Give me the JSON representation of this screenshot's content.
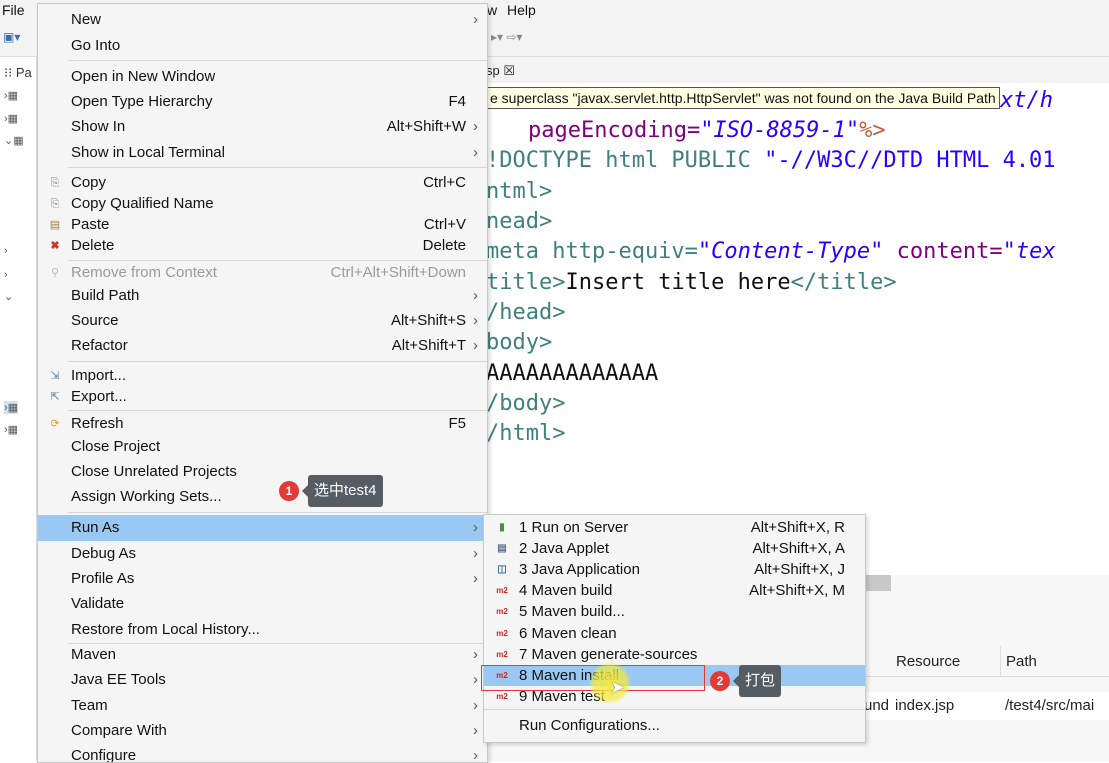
{
  "menubar": {
    "file": "File",
    "help": "Help",
    "w_fragment": "w"
  },
  "editor": {
    "tab_fragment": "sp ☒",
    "warning_tooltip": "e superclass \"javax.servlet.http.HttpServlet\" was not found on the Java Build Path",
    "code_lines": [
      {
        "a": "pageEncoding=",
        "b": "\"ISO-8859-1\"",
        "c": "%>"
      },
      {
        "a": "!DOCTYPE html PUBLIC ",
        "b": "\"-//W3C//DTD HTML 4.01"
      },
      {
        "a": "ntml>"
      },
      {
        "a": "nead>"
      },
      {
        "a": "meta http-equiv=",
        "b": "\"Content-Type\"",
        "c": " content=",
        "d": "\"tex"
      },
      {
        "a": "title>",
        "b": "Insert title here",
        "c": "</title>"
      },
      {
        "a": "/head>"
      },
      {
        "a": "body>"
      },
      {
        "a": "AAAAAAAAAAAAA"
      },
      {
        "a": "/body>"
      },
      {
        "a": "/html>"
      }
    ],
    "top_fragment": "xt/h"
  },
  "explorer": {
    "header": "Pa"
  },
  "context_menu": {
    "items": [
      {
        "label": "New",
        "shortcut": "",
        "submenu": true
      },
      {
        "label": "Go Into",
        "shortcut": ""
      },
      {
        "label": "Open in New Window",
        "shortcut": ""
      },
      {
        "label": "Open Type Hierarchy",
        "shortcut": "F4"
      },
      {
        "label": "Show In",
        "shortcut": "Alt+Shift+W",
        "submenu": true
      },
      {
        "label": "Show in Local Terminal",
        "shortcut": "",
        "submenu": true
      },
      {
        "label": "Copy",
        "shortcut": "Ctrl+C",
        "icon": "copy-icon"
      },
      {
        "label": "Copy Qualified Name",
        "shortcut": "",
        "icon": "copy-qualified-name-icon"
      },
      {
        "label": "Paste",
        "shortcut": "Ctrl+V",
        "icon": "paste-icon"
      },
      {
        "label": "Delete",
        "shortcut": "Delete",
        "icon": "delete-icon"
      },
      {
        "label": "Remove from Context",
        "shortcut": "Ctrl+Alt+Shift+Down",
        "disabled": true
      },
      {
        "label": "Build Path",
        "shortcut": "",
        "submenu": true
      },
      {
        "label": "Source",
        "shortcut": "Alt+Shift+S",
        "submenu": true
      },
      {
        "label": "Refactor",
        "shortcut": "Alt+Shift+T",
        "submenu": true
      },
      {
        "label": "Import...",
        "shortcut": "",
        "icon": "import-icon"
      },
      {
        "label": "Export...",
        "shortcut": "",
        "icon": "export-icon"
      },
      {
        "label": "Refresh",
        "shortcut": "F5",
        "icon": "refresh-icon"
      },
      {
        "label": "Close Project",
        "shortcut": ""
      },
      {
        "label": "Close Unrelated Projects",
        "shortcut": ""
      },
      {
        "label": "Assign Working Sets...",
        "shortcut": ""
      },
      {
        "label": "Run As",
        "shortcut": "",
        "submenu": true,
        "selected": true
      },
      {
        "label": "Debug As",
        "shortcut": "",
        "submenu": true
      },
      {
        "label": "Profile As",
        "shortcut": "",
        "submenu": true
      },
      {
        "label": "Validate",
        "shortcut": ""
      },
      {
        "label": "Restore from Local History...",
        "shortcut": ""
      },
      {
        "label": "Maven",
        "shortcut": "",
        "submenu": true
      },
      {
        "label": "Java EE Tools",
        "shortcut": "",
        "submenu": true
      },
      {
        "label": "Team",
        "shortcut": "",
        "submenu": true
      },
      {
        "label": "Compare With",
        "shortcut": "",
        "submenu": true
      },
      {
        "label": "Configure",
        "shortcut": "",
        "submenu": true
      }
    ]
  },
  "run_as_submenu": {
    "items": [
      {
        "label": "1 Run on Server",
        "shortcut": "Alt+Shift+X, R",
        "icon": "server-icon"
      },
      {
        "label": "2 Java Applet",
        "shortcut": "Alt+Shift+X, A",
        "icon": "applet-icon"
      },
      {
        "label": "3 Java Application",
        "shortcut": "Alt+Shift+X, J",
        "icon": "java-application-icon"
      },
      {
        "label": "4 Maven build",
        "shortcut": "Alt+Shift+X, M",
        "icon": "m2-icon"
      },
      {
        "label": "5 Maven build...",
        "shortcut": "",
        "icon": "m2-icon"
      },
      {
        "label": "6 Maven clean",
        "shortcut": "",
        "icon": "m2-icon"
      },
      {
        "label": "7 Maven generate-sources",
        "shortcut": "",
        "icon": "m2-icon"
      },
      {
        "label": "8 Maven install",
        "shortcut": "",
        "icon": "m2-icon",
        "selected": true
      },
      {
        "label": "9 Maven test",
        "shortcut": "",
        "icon": "m2-icon"
      },
      {
        "label": "Run Configurations...",
        "shortcut": ""
      }
    ]
  },
  "problems_table": {
    "headers": [
      "Resource",
      "Path"
    ],
    "row": {
      "prefix": "und",
      "resource": "index.jsp",
      "path": "/test4/src/mai"
    }
  },
  "callouts": [
    {
      "number": "1",
      "text": "选中test4"
    },
    {
      "number": "2",
      "text": "打包"
    }
  ],
  "colors": {
    "selection": "#99c9f2",
    "badge": "#e53935",
    "callout_bg": "#555c62"
  }
}
